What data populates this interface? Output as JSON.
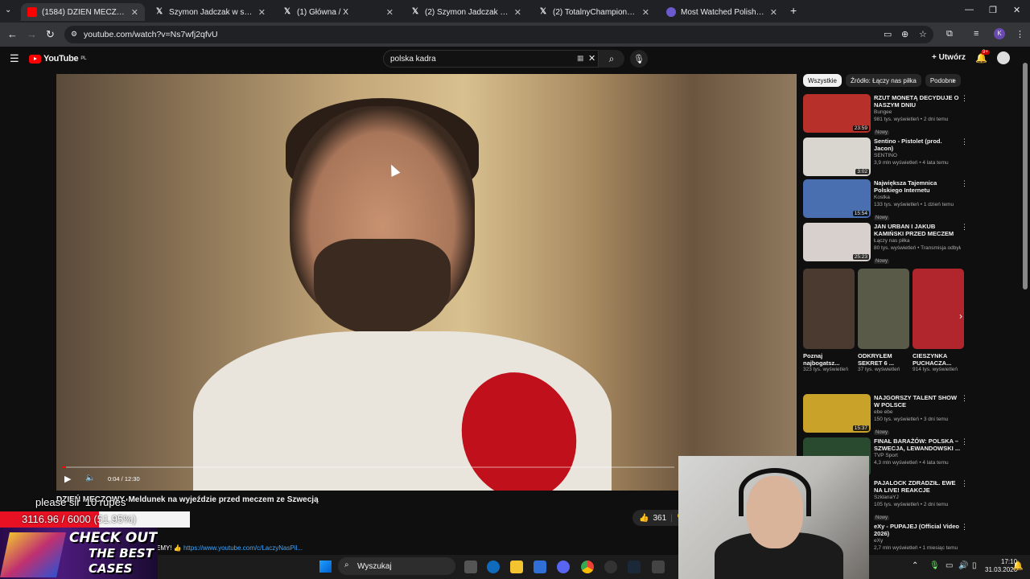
{
  "browser": {
    "tabs": [
      {
        "title": "(1584) DZIEŃ MECZOWY. Meld",
        "icon": "youtube-icon",
        "active": true
      },
      {
        "title": "Szymon Jadczak w serwisie X:",
        "icon": "x-icon"
      },
      {
        "title": "(1) Główna / X",
        "icon": "x-icon"
      },
      {
        "title": "(2) Szymon Jadczak w serwisie X",
        "icon": "x-icon"
      },
      {
        "title": "(2) TotalnyChampion 🙈🔥 w",
        "icon": "x-icon"
      },
      {
        "title": "Most Watched Polish Twitch St",
        "icon": "generic-site-icon"
      }
    ],
    "url": "youtube.com/watch?v=Ns7wfj2qfvU"
  },
  "youtube": {
    "logo": "YouTube",
    "country": "PL",
    "search_value": "polska kadra",
    "create_label": "Utwórz",
    "notifications": "9+",
    "avatar_letter": "K"
  },
  "player": {
    "time": "0:04 / 12:30",
    "progress": 0.005,
    "title": "DZIEŃ MECZOWY. Meldunek na wyjeździe przed meczem ze Szwecją",
    "likes": "361",
    "link_prefix": "EMY! 👍",
    "link": "https://www.youtube.com/c/LaczyNasPil..."
  },
  "sidebar": {
    "chips": [
      "Wszystkie",
      "Źródło: Łączy nas piłka",
      "Podobne"
    ],
    "videos": [
      {
        "title": "RZUT MONETĄ DECYDUJE O NASZYM DNIU",
        "channel": "Bungee",
        "meta": "981 tys. wyświetleń • 2 dni temu",
        "badge": "Nowy",
        "duration": "23:59",
        "color": "#b8302a"
      },
      {
        "title": "Sentino - Pistolet (prod. Jacon)",
        "channel": "SENTINO",
        "meta": "3,9 mln wyświetleń • 4 lata temu",
        "badge": "",
        "duration": "3:02",
        "color": "#d9d6d0"
      },
      {
        "title": "Największa Tajemnica Polskiego Internetu",
        "channel": "Kostka",
        "meta": "133 tys. wyświetleń • 1 dzień temu",
        "badge": "Nowy",
        "duration": "15:54",
        "color": "#4a6fb0"
      },
      {
        "title": "JAN URBAN I JAKUB KAMIŃSKI PRZED MECZEM ZE SZWECJĄ,...",
        "channel": "Łączy nas piłka",
        "meta": "80 tys. wyświetleń • Transmisja odbyła s...",
        "badge": "Nowy",
        "duration": "25:23",
        "color": "#d8d0cc"
      },
      {
        "title": "NAJGORSZY TALENT SHOW W POLSCE",
        "channel": "ebe ebe",
        "meta": "150 tys. wyświetleń • 3 dni temu",
        "badge": "Nowy",
        "duration": "15:37",
        "color": "#c9a22a"
      },
      {
        "title": "FINAŁ BARAŻÓW: POLSKA – SZWECJA, LEWANDOWSKI ...",
        "channel": "TVP Sport",
        "meta": "4,3 mln wyświetleń • 4 lata temu",
        "badge": "",
        "duration": "",
        "color": "#2a4a30"
      },
      {
        "title": "PAJALOCK ZDRADZIŁ. EWE NA LIVE! REAKCJE STREAMERÓ...",
        "channel": "SzklanaYJ",
        "meta": "105 tys. wyświetleń • 2 dni temu",
        "badge": "Nowy",
        "duration": "",
        "color": "#333"
      },
      {
        "title": "eXy - PUPAJEJ (Official Video 2026)",
        "channel": "eXy",
        "meta": "2,7 mln wyświetleń • 1 miesiąc temu",
        "badge": "",
        "duration": "",
        "color": "#333"
      }
    ],
    "shorts": [
      {
        "title": "Poznaj najbogatsz...",
        "views": "323 tys. wyświetleń",
        "color": "#4a3a30"
      },
      {
        "title": "ODKRYŁEM SEKRET 6 ...",
        "views": "37 tys. wyświetleń",
        "color": "#5a5a48"
      },
      {
        "title": "CIESZYNKA PUCHACZA...",
        "views": "914 tys. wyświetleń",
        "color": "#b0262c"
      }
    ]
  },
  "stream_overlay": {
    "chat_message": "please sir '10 rupes'",
    "goal_text": "3116.96 / 6000 (51.95%)",
    "goal_fraction": 0.5195,
    "promo_line1": "CHECK OUT",
    "promo_line2": "THE BEST",
    "promo_line3": "CASES"
  },
  "taskbar": {
    "search_placeholder": "Wyszukaj",
    "time": "17:10",
    "date": "31.03.2026"
  }
}
